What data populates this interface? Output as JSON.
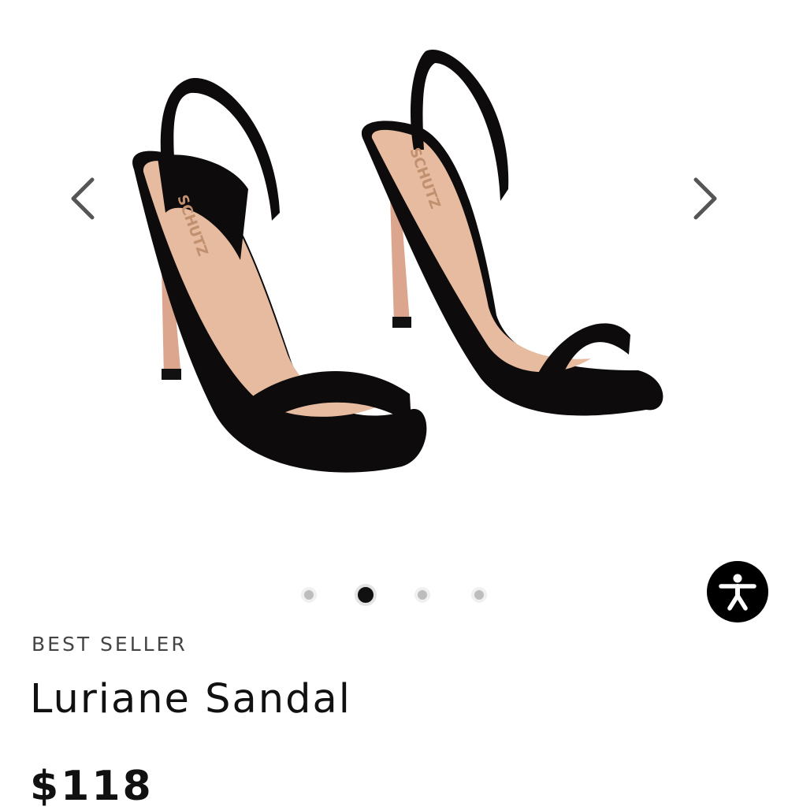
{
  "gallery": {
    "prev_icon": "chevron-left-icon",
    "next_icon": "chevron-right-icon",
    "brand_on_insole": "SCHUTZ",
    "dot_count": 4,
    "active_dot": 2,
    "colors": {
      "strap": "#0d0b0b",
      "insole": "#e6bba0",
      "heel": "#dca58e",
      "arrow": "#555555",
      "dot": "#bdbdbd",
      "dot_active": "#111111"
    }
  },
  "accessibility": {
    "icon": "accessibility-icon"
  },
  "product": {
    "badge": "BEST SELLER",
    "name": "Luriane Sandal",
    "price": "$118"
  }
}
